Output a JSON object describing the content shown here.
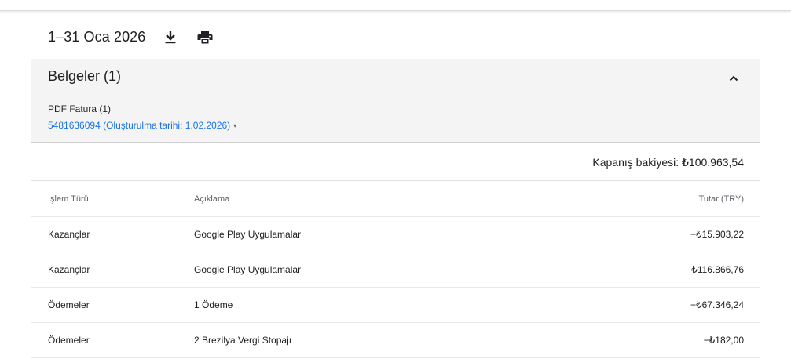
{
  "header": {
    "period": "1–31 Oca 2026"
  },
  "documents": {
    "title": "Belgeler (1)",
    "pdf_label": "PDF Fatura (1)",
    "pdf_link": "5481636094 (Oluşturulma tarihi: 1.02.2026)"
  },
  "summary": {
    "closing_balance": "Kapanış bakiyesi: ₺100.963,54"
  },
  "table": {
    "columns": [
      "İşlem Türü",
      "Açıklama",
      "Tutar (TRY)"
    ],
    "rows": [
      {
        "type": "Kazançlar",
        "description": "Google Play Uygulamalar",
        "amount": "−₺15.903,22"
      },
      {
        "type": "Kazançlar",
        "description": "Google Play Uygulamalar",
        "amount": "₺116.866,76"
      },
      {
        "type": "Ödemeler",
        "description": "1 Ödeme",
        "amount": "−₺67.346,24"
      },
      {
        "type": "Ödemeler",
        "description": "2 Brezilya Vergi Stopajı",
        "amount": "−₺182,00"
      }
    ]
  },
  "icons": {
    "download": "download-icon",
    "print": "print-icon",
    "collapse": "chevron-up-icon",
    "link_caret": "caret-down-icon"
  },
  "colors": {
    "link": "#1a73e8",
    "panel_bg": "#f4f4f4",
    "text": "#202124",
    "muted": "#5f6368"
  }
}
